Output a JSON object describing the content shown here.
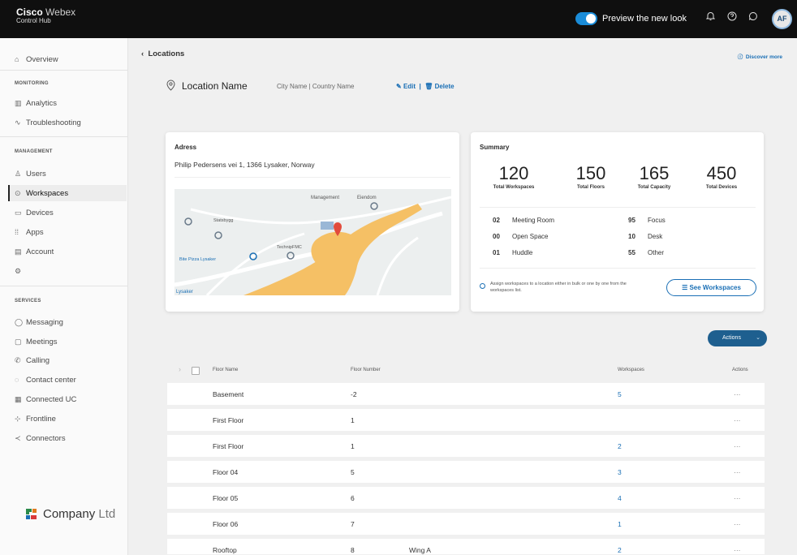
{
  "header": {
    "brand": "Cisco",
    "brand_product": "Webex",
    "subtitle": "Control Hub",
    "preview_label": "Preview the new look",
    "avatar_initials": "AF"
  },
  "sidebar": {
    "overview": "Overview",
    "monitoring_section": "MONITORING",
    "analytics": "Analytics",
    "troubleshooting": "Troubleshooting",
    "management_section": "MANAGEMENT",
    "users": "Users",
    "workspaces": "Workspaces",
    "devices": "Devices",
    "apps": "Apps",
    "account": "Account",
    "services_section": "SERVICES",
    "messaging": "Messaging",
    "meetings": "Meetings",
    "calling": "Calling",
    "contact_center": "Contact center",
    "connected_uc": "Connected UC",
    "frontline": "Frontline",
    "connectors": "Connectors",
    "company_name": "Company",
    "company_suffix": "Ltd"
  },
  "main": {
    "back_label": "Locations",
    "help_link": "Discover more",
    "location_name": "Location Name",
    "location_meta": "City Name  |  Country Name",
    "edit_label": "Edit",
    "delete_label": "Delete"
  },
  "address_card": {
    "title": "Adress",
    "address": "Philip Pedersens vei 1, 1366 Lysaker, Norway"
  },
  "summary_card": {
    "title": "Summary",
    "stats": [
      {
        "value": "120",
        "label": "Total Workspaces"
      },
      {
        "value": "150",
        "label": "Total Floors"
      },
      {
        "value": "165",
        "label": "Total Capacity"
      },
      {
        "value": "450",
        "label": "Total Devices"
      }
    ],
    "counts_left": [
      {
        "n": "02",
        "label": "Meeting Room"
      },
      {
        "n": "00",
        "label": "Open Space"
      },
      {
        "n": "01",
        "label": "Huddle"
      }
    ],
    "counts_right": [
      {
        "n": "95",
        "label": "Focus"
      },
      {
        "n": "10",
        "label": "Desk"
      },
      {
        "n": "55",
        "label": "Other"
      }
    ],
    "note": "Assign workspaces to a location either in bulk or one by one from the workspaces list.",
    "see_workspaces": "See Workspaces"
  },
  "actions_button": "Actions",
  "table": {
    "columns": [
      "Floor Name",
      "Floor Number",
      "Workspaces",
      "Actions"
    ],
    "rows": [
      {
        "floor_name": "Basement",
        "floor_number": "-2",
        "wing": "",
        "workspaces": "5",
        "actions": "···"
      },
      {
        "floor_name": "First Floor",
        "floor_number": "1",
        "wing": "",
        "workspaces": "",
        "actions": "···"
      },
      {
        "floor_name": "First Floor",
        "floor_number": "1",
        "wing": "",
        "workspaces": "2",
        "actions": "···"
      },
      {
        "floor_name": "Floor 04",
        "floor_number": "5",
        "wing": "",
        "workspaces": "3",
        "actions": "···"
      },
      {
        "floor_name": "Floor 05",
        "floor_number": "6",
        "wing": "",
        "workspaces": "4",
        "actions": "···"
      },
      {
        "floor_name": "Floor 06",
        "floor_number": "7",
        "wing": "",
        "workspaces": "1",
        "actions": "···"
      },
      {
        "floor_name": "Rooftop",
        "floor_number": "8",
        "wing": "Wing A",
        "workspaces": "2",
        "actions": "···"
      }
    ]
  },
  "map": {
    "labels": [
      "Management",
      "Eiendom",
      "Statsbygg",
      "TechnipFMC",
      "Bite Pizza Lysaker",
      "Lysaker"
    ]
  },
  "colors": {
    "accent": "#1a6fb5",
    "topbar": "#0f0f0f",
    "toggle": "#1a8cd8",
    "actions_button": "#1e5f8f",
    "map_road": "#f5c065"
  }
}
